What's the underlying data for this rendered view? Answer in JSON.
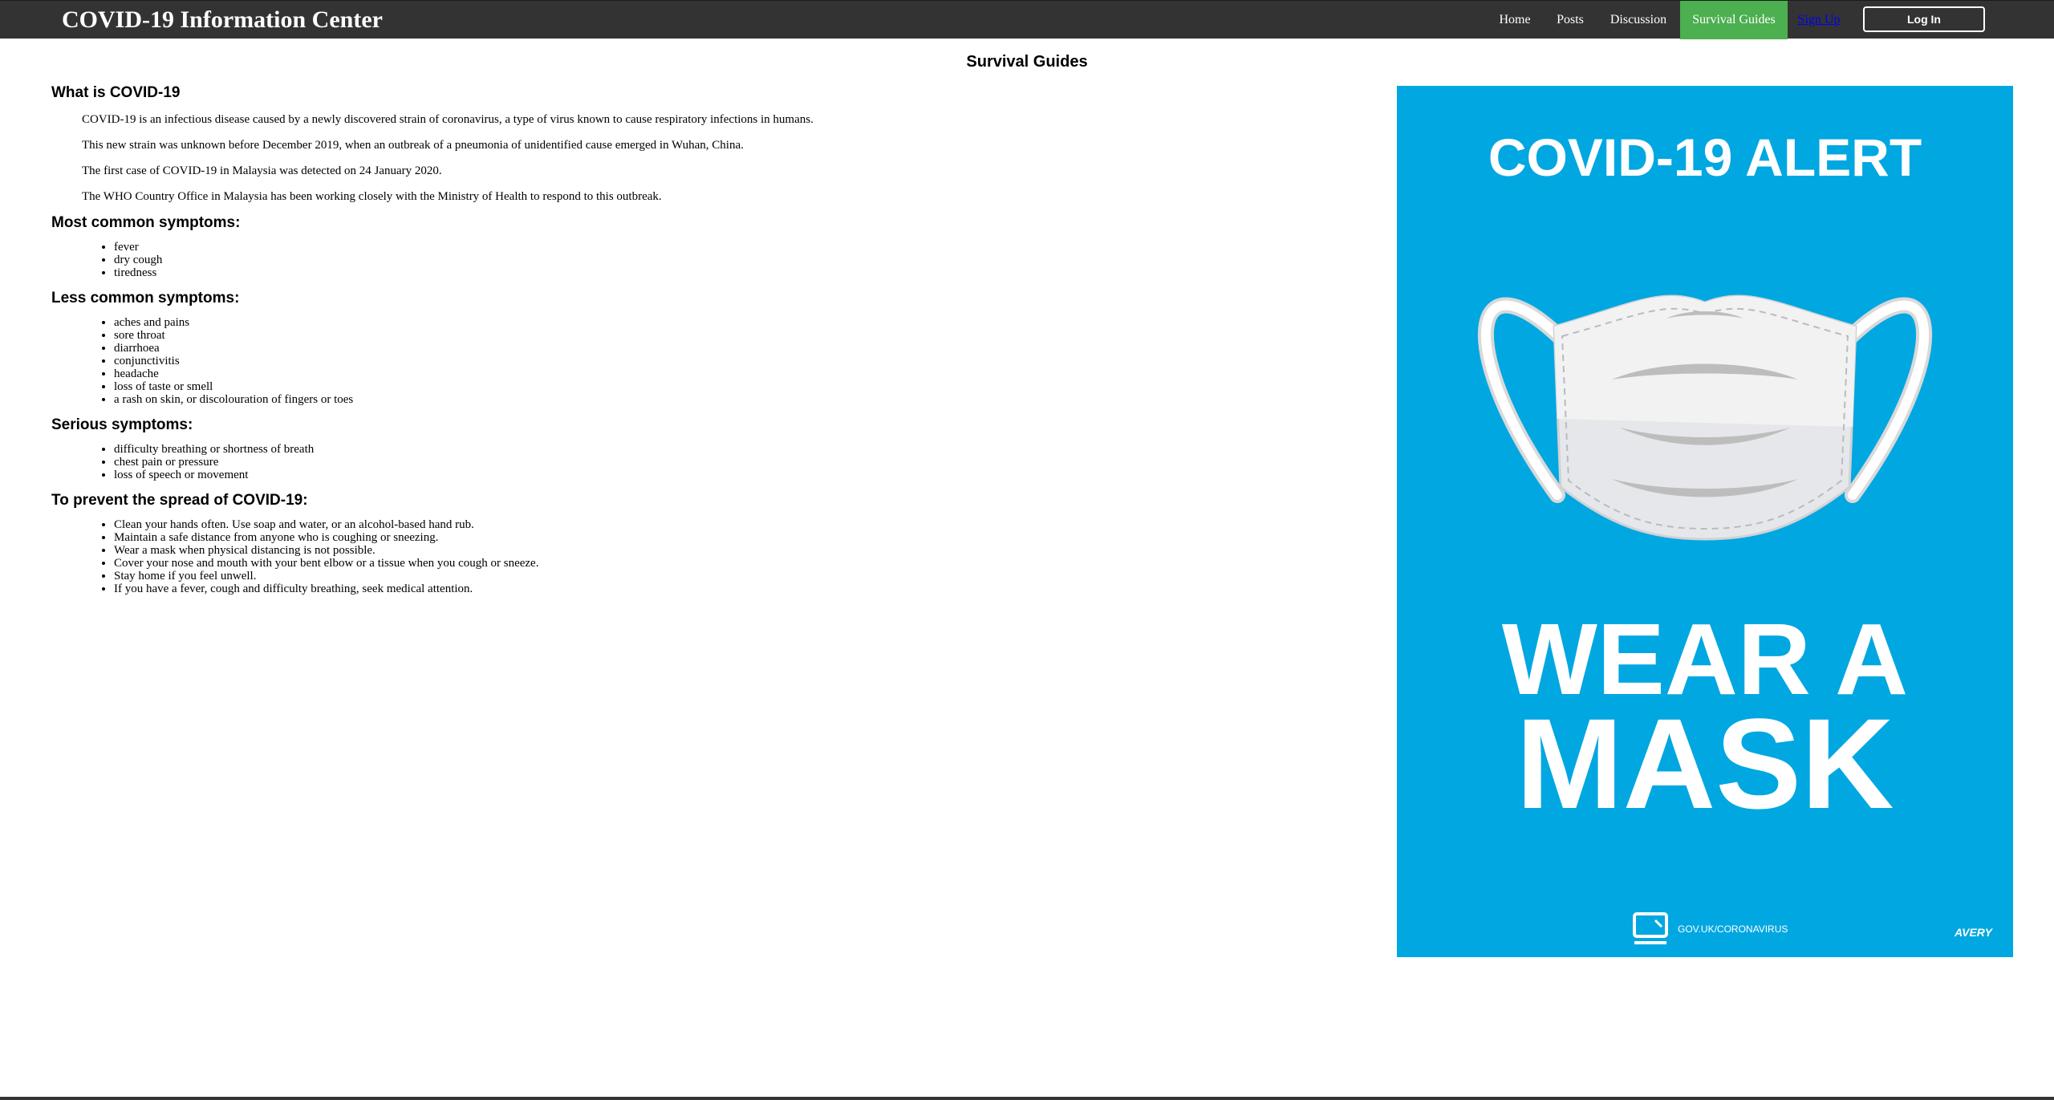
{
  "brand": "COVID-19 Information Center",
  "nav": {
    "home": "Home",
    "posts": "Posts",
    "discussion": "Discussion",
    "survival_guides": "Survival Guides",
    "sign_up": "Sign Up",
    "log_in": "Log In"
  },
  "colors": {
    "nav_bg": "#333333",
    "active_tab": "#4caf50",
    "sign_up_link": "#0000ee",
    "poster_bg": "#00a7e1"
  },
  "page": {
    "title": "Survival Guides",
    "sections": [
      {
        "heading": "What is COVID-19",
        "paragraphs": [
          "COVID-19 is an infectious disease caused by a newly discovered strain of coronavirus, a type of virus known to cause respiratory infections in humans.",
          "This new strain was unknown before December 2019, when an outbreak of a pneumonia of unidentified cause emerged in Wuhan, China.",
          "The first case of COVID-19 in Malaysia was detected on 24 January 2020.",
          "The WHO Country Office in Malaysia has been working closely with the Ministry of Health to respond to this outbreak."
        ]
      },
      {
        "heading": "Most common symptoms:",
        "items": [
          "fever",
          "dry cough",
          "tiredness"
        ]
      },
      {
        "heading": "Less common symptoms:",
        "items": [
          "aches and pains",
          "sore throat",
          "diarrhoea",
          "conjunctivitis",
          "headache",
          "loss of taste or smell",
          "a rash on skin, or discolouration of fingers or toes"
        ]
      },
      {
        "heading": "Serious symptoms:",
        "items": [
          "difficulty breathing or shortness of breath",
          "chest pain or pressure",
          "loss of speech or movement"
        ]
      },
      {
        "heading": "To prevent the spread of COVID-19:",
        "items": [
          "Clean your hands often. Use soap and water, or an alcohol-based hand rub.",
          "Maintain a safe distance from anyone who is coughing or sneezing.",
          "Wear a mask when physical distancing is not possible.",
          "Cover your nose and mouth with your bent elbow or a tissue when you cough or sneeze.",
          "Stay home if you feel unwell.",
          "If you have a fever, cough and difficulty breathing, seek medical attention."
        ]
      }
    ]
  },
  "poster": {
    "alert": "COVID-19 ALERT",
    "line1": "WEAR A",
    "line2": "MASK",
    "url": "GOV.UK/CORONAVIRUS",
    "logo": "AVERY",
    "icons": [
      "face-mask-icon",
      "computer-icon"
    ]
  }
}
